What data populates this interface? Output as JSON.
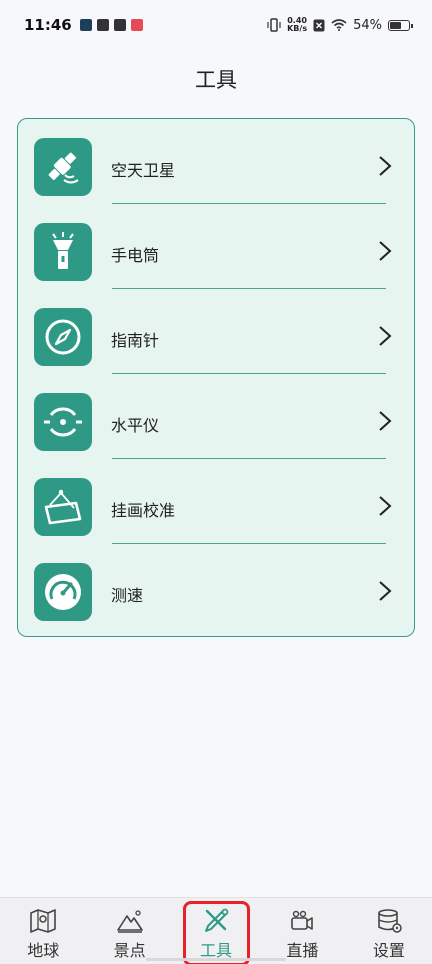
{
  "status_bar": {
    "time": "11:46",
    "net_speed_value": "0.40",
    "net_speed_unit": "KB/s",
    "battery": "54%"
  },
  "header": {
    "title": "工具"
  },
  "tools": [
    {
      "label": "空天卫星",
      "icon": "satellite-icon"
    },
    {
      "label": "手电筒",
      "icon": "flashlight-icon"
    },
    {
      "label": "指南针",
      "icon": "compass-icon"
    },
    {
      "label": "水平仪",
      "icon": "level-icon"
    },
    {
      "label": "挂画校准",
      "icon": "picture-frame-icon"
    },
    {
      "label": "测速",
      "icon": "speedometer-icon"
    }
  ],
  "bottom_nav": [
    {
      "label": "地球",
      "icon": "map-icon",
      "active": false
    },
    {
      "label": "景点",
      "icon": "mountain-icon",
      "active": false
    },
    {
      "label": "工具",
      "icon": "tools-icon",
      "active": true
    },
    {
      "label": "直播",
      "icon": "video-camera-icon",
      "active": false
    },
    {
      "label": "设置",
      "icon": "database-settings-icon",
      "active": false
    }
  ],
  "colors": {
    "accent": "#2e9a86",
    "card_background": "#e7f5f1",
    "highlight_outline": "#e8212b"
  }
}
